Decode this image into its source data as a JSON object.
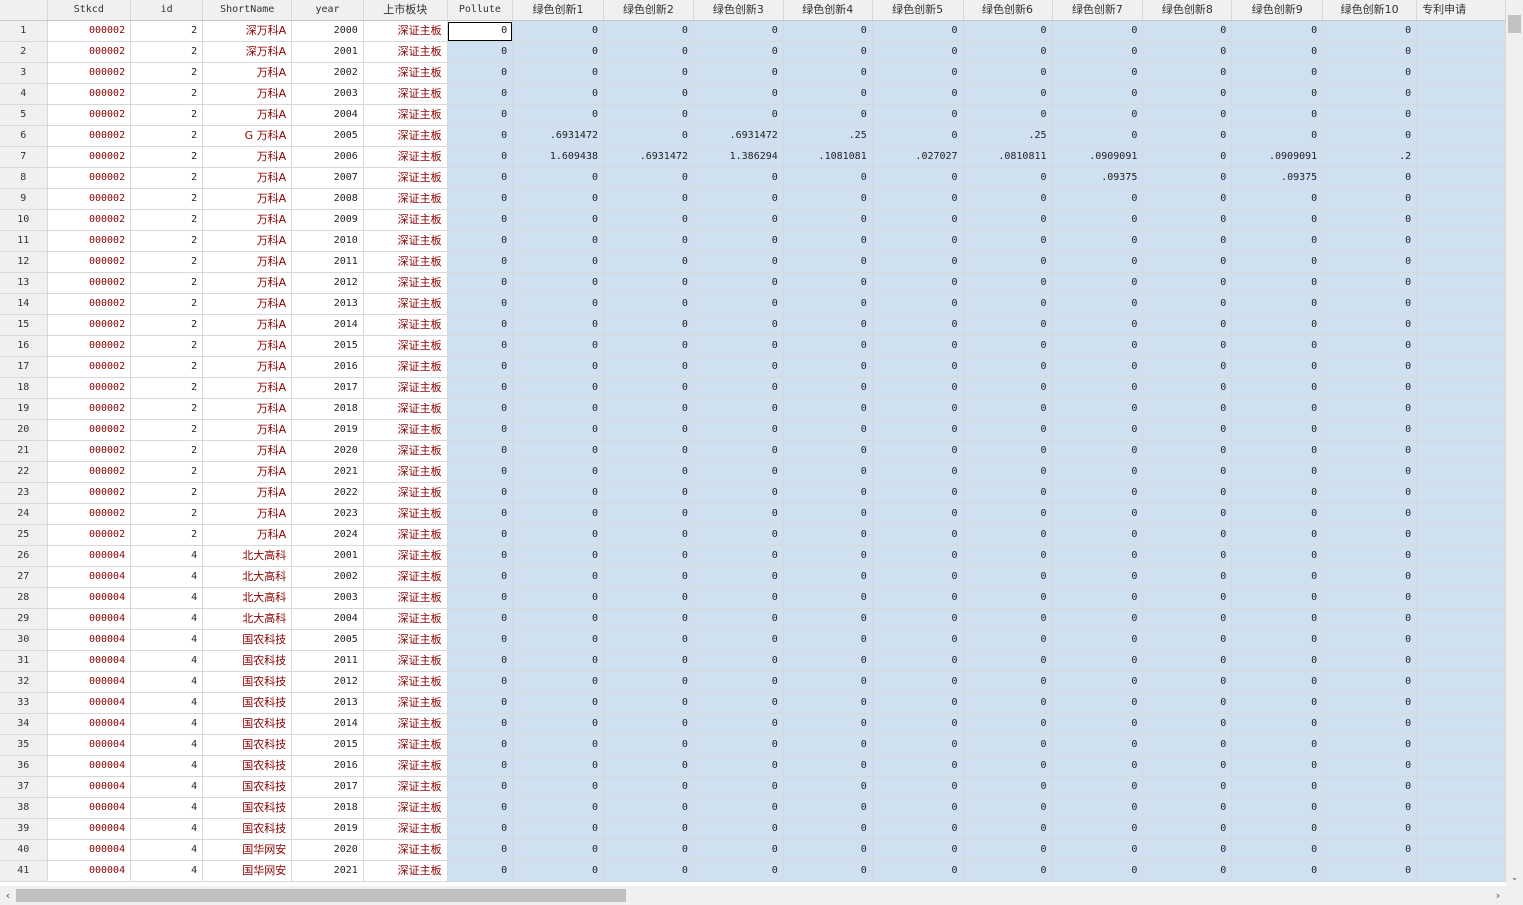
{
  "columns": [
    "",
    "Stkcd",
    "id",
    "ShortName",
    "year",
    "上市板块",
    "Pollute",
    "绿色创新1",
    "绿色创新2",
    "绿色创新3",
    "绿色创新4",
    "绿色创新5",
    "绿色创新6",
    "绿色创新7",
    "绿色创新8",
    "绿色创新9",
    "绿色创新10",
    "专利申请"
  ],
  "rows": [
    [
      "1",
      "000002",
      "2",
      "深万科A",
      "2000",
      "深证主板",
      "0",
      "0",
      "0",
      "0",
      "0",
      "0",
      "0",
      "0",
      "0",
      "0",
      "0"
    ],
    [
      "2",
      "000002",
      "2",
      "深万科A",
      "2001",
      "深证主板",
      "0",
      "0",
      "0",
      "0",
      "0",
      "0",
      "0",
      "0",
      "0",
      "0",
      "0"
    ],
    [
      "3",
      "000002",
      "2",
      "万科A",
      "2002",
      "深证主板",
      "0",
      "0",
      "0",
      "0",
      "0",
      "0",
      "0",
      "0",
      "0",
      "0",
      "0"
    ],
    [
      "4",
      "000002",
      "2",
      "万科A",
      "2003",
      "深证主板",
      "0",
      "0",
      "0",
      "0",
      "0",
      "0",
      "0",
      "0",
      "0",
      "0",
      "0"
    ],
    [
      "5",
      "000002",
      "2",
      "万科A",
      "2004",
      "深证主板",
      "0",
      "0",
      "0",
      "0",
      "0",
      "0",
      "0",
      "0",
      "0",
      "0",
      "0"
    ],
    [
      "6",
      "000002",
      "2",
      "G 万科A",
      "2005",
      "深证主板",
      "0",
      ".6931472",
      "0",
      ".6931472",
      ".25",
      "0",
      ".25",
      "0",
      "0",
      "0",
      "0"
    ],
    [
      "7",
      "000002",
      "2",
      "万科A",
      "2006",
      "深证主板",
      "0",
      "1.609438",
      ".6931472",
      "1.386294",
      ".1081081",
      ".027027",
      ".0810811",
      ".0909091",
      "0",
      ".0909091",
      ".2"
    ],
    [
      "8",
      "000002",
      "2",
      "万科A",
      "2007",
      "深证主板",
      "0",
      "0",
      "0",
      "0",
      "0",
      "0",
      "0",
      ".09375",
      "0",
      ".09375",
      "0"
    ],
    [
      "9",
      "000002",
      "2",
      "万科A",
      "2008",
      "深证主板",
      "0",
      "0",
      "0",
      "0",
      "0",
      "0",
      "0",
      "0",
      "0",
      "0",
      "0"
    ],
    [
      "10",
      "000002",
      "2",
      "万科A",
      "2009",
      "深证主板",
      "0",
      "0",
      "0",
      "0",
      "0",
      "0",
      "0",
      "0",
      "0",
      "0",
      "0"
    ],
    [
      "11",
      "000002",
      "2",
      "万科A",
      "2010",
      "深证主板",
      "0",
      "0",
      "0",
      "0",
      "0",
      "0",
      "0",
      "0",
      "0",
      "0",
      "0"
    ],
    [
      "12",
      "000002",
      "2",
      "万科A",
      "2011",
      "深证主板",
      "0",
      "0",
      "0",
      "0",
      "0",
      "0",
      "0",
      "0",
      "0",
      "0",
      "0"
    ],
    [
      "13",
      "000002",
      "2",
      "万科A",
      "2012",
      "深证主板",
      "0",
      "0",
      "0",
      "0",
      "0",
      "0",
      "0",
      "0",
      "0",
      "0",
      "0"
    ],
    [
      "14",
      "000002",
      "2",
      "万科A",
      "2013",
      "深证主板",
      "0",
      "0",
      "0",
      "0",
      "0",
      "0",
      "0",
      "0",
      "0",
      "0",
      "0"
    ],
    [
      "15",
      "000002",
      "2",
      "万科A",
      "2014",
      "深证主板",
      "0",
      "0",
      "0",
      "0",
      "0",
      "0",
      "0",
      "0",
      "0",
      "0",
      "0"
    ],
    [
      "16",
      "000002",
      "2",
      "万科A",
      "2015",
      "深证主板",
      "0",
      "0",
      "0",
      "0",
      "0",
      "0",
      "0",
      "0",
      "0",
      "0",
      "0"
    ],
    [
      "17",
      "000002",
      "2",
      "万科A",
      "2016",
      "深证主板",
      "0",
      "0",
      "0",
      "0",
      "0",
      "0",
      "0",
      "0",
      "0",
      "0",
      "0"
    ],
    [
      "18",
      "000002",
      "2",
      "万科A",
      "2017",
      "深证主板",
      "0",
      "0",
      "0",
      "0",
      "0",
      "0",
      "0",
      "0",
      "0",
      "0",
      "0"
    ],
    [
      "19",
      "000002",
      "2",
      "万科A",
      "2018",
      "深证主板",
      "0",
      "0",
      "0",
      "0",
      "0",
      "0",
      "0",
      "0",
      "0",
      "0",
      "0"
    ],
    [
      "20",
      "000002",
      "2",
      "万科A",
      "2019",
      "深证主板",
      "0",
      "0",
      "0",
      "0",
      "0",
      "0",
      "0",
      "0",
      "0",
      "0",
      "0"
    ],
    [
      "21",
      "000002",
      "2",
      "万科A",
      "2020",
      "深证主板",
      "0",
      "0",
      "0",
      "0",
      "0",
      "0",
      "0",
      "0",
      "0",
      "0",
      "0"
    ],
    [
      "22",
      "000002",
      "2",
      "万科A",
      "2021",
      "深证主板",
      "0",
      "0",
      "0",
      "0",
      "0",
      "0",
      "0",
      "0",
      "0",
      "0",
      "0"
    ],
    [
      "23",
      "000002",
      "2",
      "万科A",
      "2022",
      "深证主板",
      "0",
      "0",
      "0",
      "0",
      "0",
      "0",
      "0",
      "0",
      "0",
      "0",
      "0"
    ],
    [
      "24",
      "000002",
      "2",
      "万科A",
      "2023",
      "深证主板",
      "0",
      "0",
      "0",
      "0",
      "0",
      "0",
      "0",
      "0",
      "0",
      "0",
      "0"
    ],
    [
      "25",
      "000002",
      "2",
      "万科A",
      "2024",
      "深证主板",
      "0",
      "0",
      "0",
      "0",
      "0",
      "0",
      "0",
      "0",
      "0",
      "0",
      "0"
    ],
    [
      "26",
      "000004",
      "4",
      "北大高科",
      "2001",
      "深证主板",
      "0",
      "0",
      "0",
      "0",
      "0",
      "0",
      "0",
      "0",
      "0",
      "0",
      "0"
    ],
    [
      "27",
      "000004",
      "4",
      "北大高科",
      "2002",
      "深证主板",
      "0",
      "0",
      "0",
      "0",
      "0",
      "0",
      "0",
      "0",
      "0",
      "0",
      "0"
    ],
    [
      "28",
      "000004",
      "4",
      "北大高科",
      "2003",
      "深证主板",
      "0",
      "0",
      "0",
      "0",
      "0",
      "0",
      "0",
      "0",
      "0",
      "0",
      "0"
    ],
    [
      "29",
      "000004",
      "4",
      "北大高科",
      "2004",
      "深证主板",
      "0",
      "0",
      "0",
      "0",
      "0",
      "0",
      "0",
      "0",
      "0",
      "0",
      "0"
    ],
    [
      "30",
      "000004",
      "4",
      "国农科技",
      "2005",
      "深证主板",
      "0",
      "0",
      "0",
      "0",
      "0",
      "0",
      "0",
      "0",
      "0",
      "0",
      "0"
    ],
    [
      "31",
      "000004",
      "4",
      "国农科技",
      "2011",
      "深证主板",
      "0",
      "0",
      "0",
      "0",
      "0",
      "0",
      "0",
      "0",
      "0",
      "0",
      "0"
    ],
    [
      "32",
      "000004",
      "4",
      "国农科技",
      "2012",
      "深证主板",
      "0",
      "0",
      "0",
      "0",
      "0",
      "0",
      "0",
      "0",
      "0",
      "0",
      "0"
    ],
    [
      "33",
      "000004",
      "4",
      "国农科技",
      "2013",
      "深证主板",
      "0",
      "0",
      "0",
      "0",
      "0",
      "0",
      "0",
      "0",
      "0",
      "0",
      "0"
    ],
    [
      "34",
      "000004",
      "4",
      "国农科技",
      "2014",
      "深证主板",
      "0",
      "0",
      "0",
      "0",
      "0",
      "0",
      "0",
      "0",
      "0",
      "0",
      "0"
    ],
    [
      "35",
      "000004",
      "4",
      "国农科技",
      "2015",
      "深证主板",
      "0",
      "0",
      "0",
      "0",
      "0",
      "0",
      "0",
      "0",
      "0",
      "0",
      "0"
    ],
    [
      "36",
      "000004",
      "4",
      "国农科技",
      "2016",
      "深证主板",
      "0",
      "0",
      "0",
      "0",
      "0",
      "0",
      "0",
      "0",
      "0",
      "0",
      "0"
    ],
    [
      "37",
      "000004",
      "4",
      "国农科技",
      "2017",
      "深证主板",
      "0",
      "0",
      "0",
      "0",
      "0",
      "0",
      "0",
      "0",
      "0",
      "0",
      "0"
    ],
    [
      "38",
      "000004",
      "4",
      "国农科技",
      "2018",
      "深证主板",
      "0",
      "0",
      "0",
      "0",
      "0",
      "0",
      "0",
      "0",
      "0",
      "0",
      "0"
    ],
    [
      "39",
      "000004",
      "4",
      "国农科技",
      "2019",
      "深证主板",
      "0",
      "0",
      "0",
      "0",
      "0",
      "0",
      "0",
      "0",
      "0",
      "0",
      "0"
    ],
    [
      "40",
      "000004",
      "4",
      "国华网安",
      "2020",
      "深证主板",
      "0",
      "0",
      "0",
      "0",
      "0",
      "0",
      "0",
      "0",
      "0",
      "0",
      "0"
    ],
    [
      "41",
      "000004",
      "4",
      "国华网安",
      "2021",
      "深证主板",
      "0",
      "0",
      "0",
      "0",
      "0",
      "0",
      "0",
      "0",
      "0",
      "0",
      "0"
    ]
  ],
  "colors": {
    "string_text": "#8b0000",
    "selection": "#cfe1f1",
    "header_bg": "#f0f0f0"
  },
  "icons": {
    "scroll_down": "chevron-down-icon",
    "scroll_left": "chevron-left-icon",
    "scroll_right": "chevron-right-icon"
  }
}
